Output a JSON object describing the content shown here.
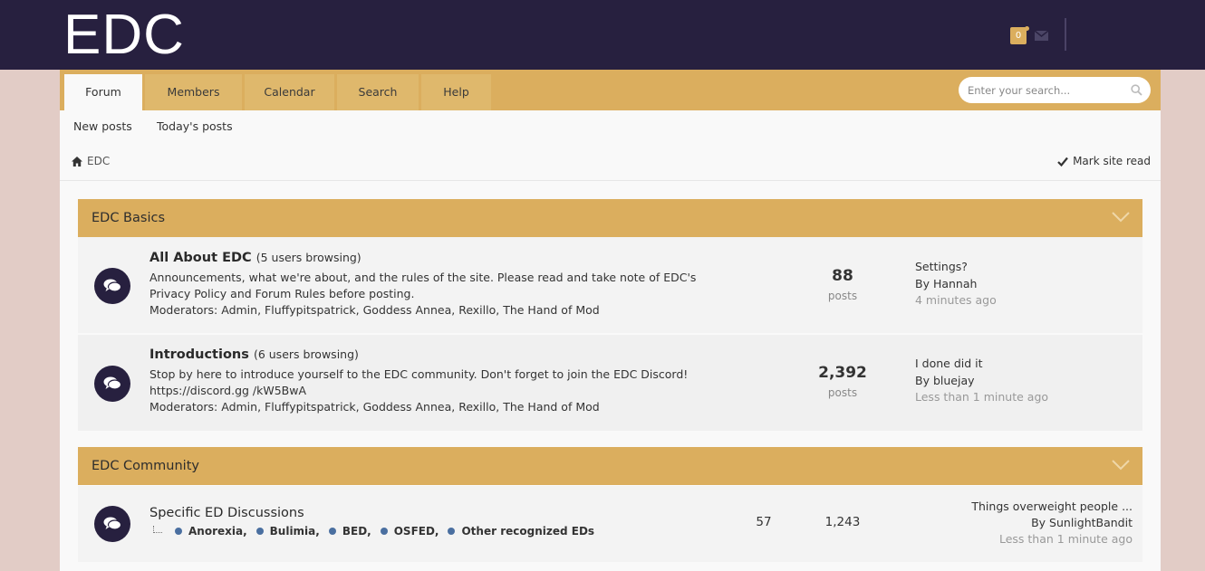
{
  "header": {
    "logo": "EDC",
    "notification_count": "0"
  },
  "nav": {
    "tabs": [
      {
        "label": "Forum",
        "active": true
      },
      {
        "label": "Members"
      },
      {
        "label": "Calendar"
      },
      {
        "label": "Search"
      },
      {
        "label": "Help"
      }
    ],
    "search_placeholder": "Enter your search..."
  },
  "subnav": {
    "new_posts": "New posts",
    "todays_posts": "Today's posts"
  },
  "breadcrumb": {
    "current": "EDC",
    "mark_read": "Mark site read"
  },
  "categories": [
    {
      "title": "EDC Basics",
      "forums": [
        {
          "title": "All About EDC",
          "browsing": "(5 users browsing)",
          "description": "Announcements, what we're about, and the rules of the site. Please read and take note of EDC's Privacy Policy and Forum Rules before posting.",
          "moderators": "Moderators: Admin, Fluffypitspatrick, Goddess Annea, Rexillo, The Hand of Mod",
          "posts": "88",
          "posts_label": "posts",
          "last_title": "Settings?",
          "last_by": "By Hannah",
          "last_time": "4 minutes ago"
        },
        {
          "title": "Introductions",
          "browsing": "(6 users browsing)",
          "description": "Stop by here to introduce yourself to the EDC community. Don't forget to join the EDC Discord! https://discord.gg /kW5BwA",
          "moderators": "Moderators: Admin, Fluffypitspatrick, Goddess Annea, Rexillo, The Hand of Mod",
          "posts": "2,392",
          "posts_label": "posts",
          "last_title": "I done did it",
          "last_by": "By bluejay",
          "last_time": "Less than 1 minute ago"
        }
      ]
    },
    {
      "title": "EDC Community",
      "forums": [
        {
          "title": "Specific ED Discussions",
          "subforums": [
            "Anorexia,",
            "Bulimia,",
            "BED,",
            "OSFED,",
            "Other recognized EDs"
          ],
          "threads": "57",
          "posts": "1,243",
          "last_title": "Things overweight people ...",
          "last_by": "By SunlightBandit",
          "last_time": "Less than 1 minute ago"
        }
      ]
    }
  ],
  "colors": {
    "header_bg": "#27203f",
    "accent": "#dbae5e",
    "page_bg": "#e2ccc6"
  }
}
